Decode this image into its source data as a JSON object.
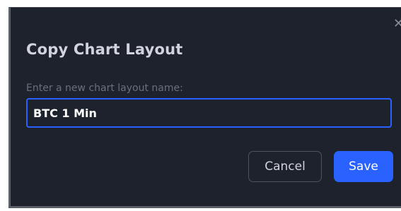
{
  "dialog": {
    "title": "Copy Chart Layout",
    "close_icon": "close-icon",
    "field_label": "Enter a new chart layout name:",
    "input_value": "BTC 1 Min",
    "cancel_label": "Cancel",
    "save_label": "Save"
  },
  "colors": {
    "background": "#1e222d",
    "accent": "#2962ff",
    "text": "#d1d4dc",
    "muted_text": "#6a6f7b"
  }
}
